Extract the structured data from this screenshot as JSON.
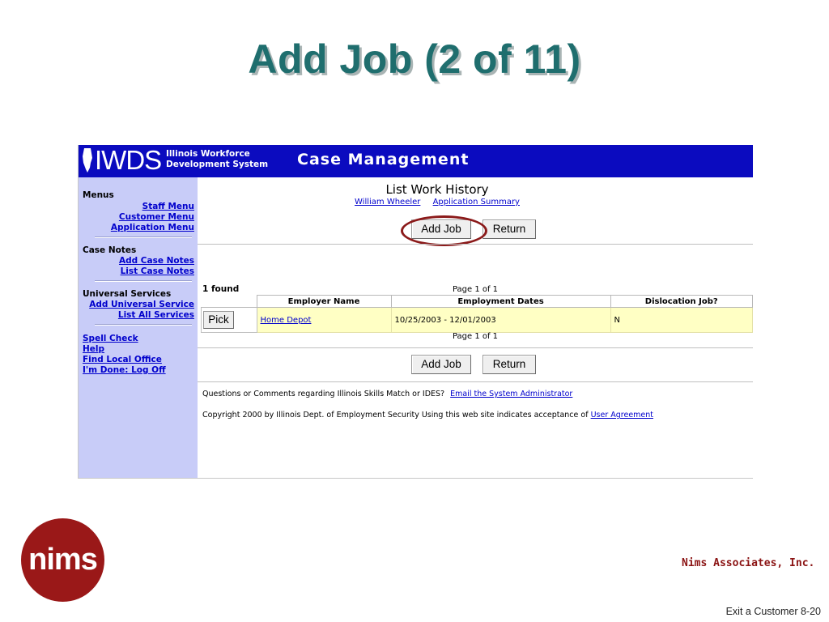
{
  "slide": {
    "title": "Add Job (2 of 11)",
    "company": "Nims Associates, Inc.",
    "logo_text": "nims",
    "page_label": "Exit a Customer 8-20"
  },
  "header": {
    "logo": "IWDS",
    "logo_line1": "Illinois Workforce",
    "logo_line2": "Development System",
    "title": "Case Management",
    "color": "#0b0bbf"
  },
  "sidebar": {
    "menus_heading": "Menus",
    "staff_menu": "Staff Menu",
    "customer_menu": "Customer Menu",
    "application_menu": "Application Menu",
    "case_notes_heading": "Case Notes",
    "add_case_notes": "Add Case Notes",
    "list_case_notes": "List Case Notes",
    "universal_heading": "Universal Services",
    "add_universal_service": "Add Universal Service",
    "list_all_services": "List All Services",
    "spell_check": "Spell Check",
    "help": "Help",
    "find_local_office": "Find Local Office",
    "log_off": "I'm Done: Log Off"
  },
  "main": {
    "title": "List Work History",
    "customer_link": "William Wheeler",
    "summary_link": "Application Summary",
    "add_job_label": "Add Job",
    "return_label": "Return",
    "found_text": "1 found",
    "page_text": "Page 1 of 1",
    "columns": [
      "Employer Name",
      "Employment Dates",
      "Dislocation Job?"
    ],
    "rows": [
      {
        "pick": "Pick",
        "employer": "Home Depot",
        "dates": "10/25/2003 - 12/01/2003",
        "dislocation": "N"
      }
    ],
    "questions_text": "Questions or Comments regarding Illinois Skills Match or IDES?",
    "email_link": "Email the System Administrator",
    "copyright_text": "Copyright 2000 by Illinois Dept. of Employment Security Using this web site indicates acceptance of",
    "agreement_link": "User Agreement"
  }
}
